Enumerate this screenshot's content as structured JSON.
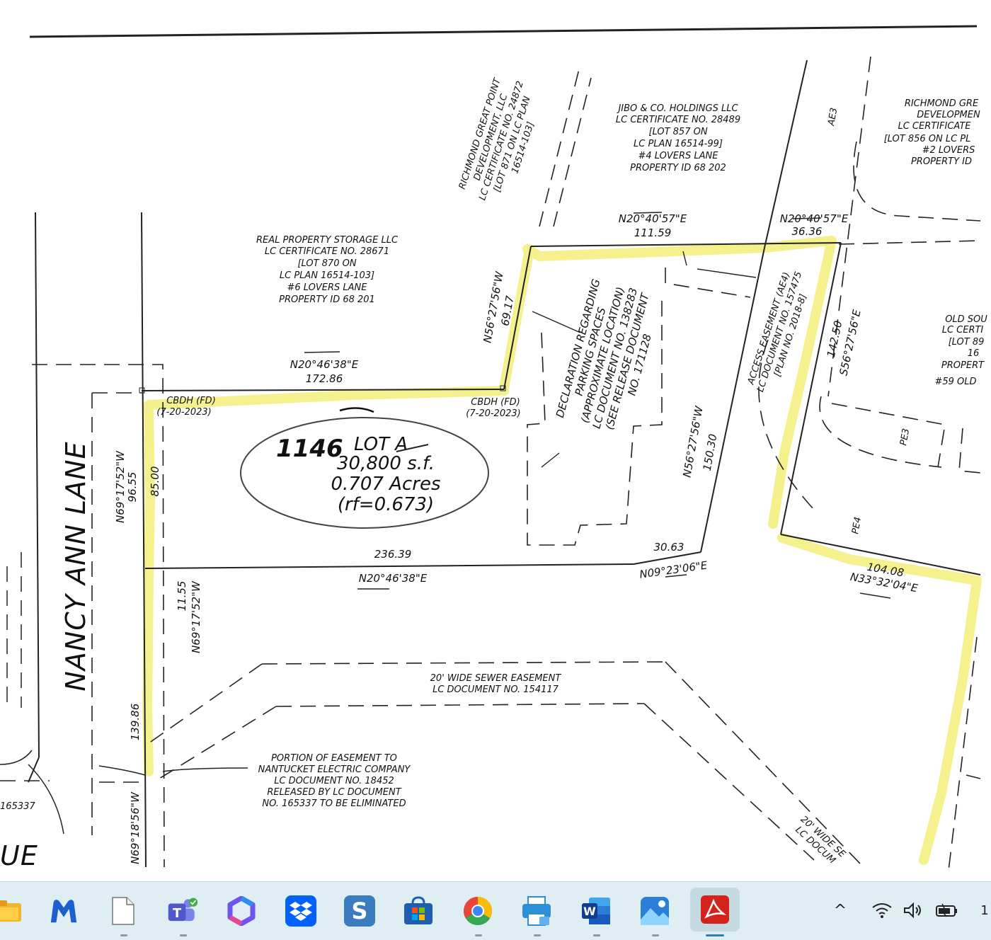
{
  "plan": {
    "top_right_owner": [
      "RICHMOND GRE",
      "DEVELOPMEN",
      "LC CERTIFICATE",
      "[LOT 856 ON LC PL",
      "#2 LOVERS",
      "PROPERTY ID"
    ],
    "jibo": [
      "JIBO & CO. HOLDINGS LLC",
      "LC CERTIFICATE NO. 28489",
      "[LOT 857 ON",
      "LC PLAN 16514-99]",
      "#4 LOVERS LANE",
      "PROPERTY ID 68 202"
    ],
    "richmond_rot": [
      "RICHMOND GREAT POINT",
      "DEVELOPMENT, LLC",
      "LC CERTIFICATE NO. 24872",
      "[LOT 871 ON LC PLAN",
      "16514-103]"
    ],
    "real_property": [
      "REAL PROPERTY STORAGE LLC",
      "LC CERTIFICATE NO. 28671",
      "[LOT 870 ON",
      "LC PLAN 16514-103]",
      "#6 LOVERS LANE",
      "PROPERTY ID 68 201"
    ],
    "old_sou": [
      "OLD SOU",
      "LC CERTI",
      "[LOT 89",
      "16",
      "PROPERT",
      "#59 OLD"
    ],
    "ae3": "AE3",
    "pe3": "PE3",
    "pe4": "PE4",
    "road_name": "NANCY ANN LANE",
    "avenue_fragment": "UE",
    "doc_fragment": "165337",
    "bearings": {
      "top_mid": "N20°40'57\"E",
      "top_mid_dist": "111.59",
      "top_right": "N20°40'57\"E",
      "top_right_dist": "36.36",
      "diag_left": "N56°27'56\"W",
      "diag_left_dist": "69.17",
      "mid_top": "N20°46'38\"E",
      "mid_top_dist": "172.86",
      "cbdh_left": "CBDH (FD)",
      "cbdh_left_date": "(7-20-2023)",
      "cbdh_right": "CBDH (FD)",
      "cbdh_right_date": "(7-20-2023)",
      "right_side_dist": "142.50",
      "right_side": "S56°27'56\"E",
      "inner_diag": "N56°27'56\"W",
      "inner_diag_dist": "150.30",
      "bottom_dist": "236.39",
      "bottom": "N20°46'38\"E",
      "short_dist": "30.63",
      "short": "N09°23'06\"E",
      "lower_right_dist": "104.08",
      "lower_right": "N33°32'04\"E",
      "left_outer": "N69°17'52\"W",
      "left_outer_dist": "96.55",
      "left_inner_dist": "85.00",
      "left_low_dist": "11.55",
      "left_low": "N69°17'52\"W",
      "left_bottom_dist": "139.86",
      "left_bottom": "N69°18'56\"W"
    },
    "parking_decl": [
      "DECLARATION REGARDING",
      "PARKING SPACES",
      "(APPROXIMATE LOCATION)",
      "LC DOCUMENT NO. 138283",
      "(SEE RELEASE DOCUMENT",
      "NO. 171128"
    ],
    "access_easement": [
      "ACCESS EASEMENT (AE4)",
      "LC DOCUMENT NO. 157475",
      "[PLAN NO. 2018-8]"
    ],
    "lot": {
      "number": "1146",
      "name": "LOT A",
      "area_sf": "30,800 s.f.",
      "area_acres": "0.707 Acres",
      "rf": "(rf=0.673)"
    },
    "sewer": [
      "20' WIDE SEWER EASEMENT",
      "LC DOCUMENT NO. 154117"
    ],
    "sewer_right": [
      "20' WIDE SE",
      "LC DOCUM"
    ],
    "electric": [
      "PORTION OF EASEMENT TO",
      "NANTUCKET ELECTRIC COMPANY",
      "LC DOCUMENT NO. 18452",
      "RELEASED BY LC DOCUMENT",
      "NO. 165337 TO BE ELIMINATED"
    ]
  },
  "taskbar": {
    "apps": [
      {
        "name": "file-explorer-icon",
        "color": "#e8a92a"
      },
      {
        "name": "malwarebytes-icon",
        "color": "#1a5fcf"
      },
      {
        "name": "blank-document-icon",
        "color": "#ffffff"
      },
      {
        "name": "teams-icon",
        "color": "#5b5fc7"
      },
      {
        "name": "copilot-icon",
        "color": "#7a5cf0"
      },
      {
        "name": "dropbox-icon",
        "color": "#0061fe"
      },
      {
        "name": "s-app-icon",
        "color": "#3b7bbf"
      },
      {
        "name": "microsoft-store-icon",
        "color": "#1f6fd1"
      },
      {
        "name": "chrome-icon",
        "color": "#e8453c"
      },
      {
        "name": "printer-app-icon",
        "color": "#2d8fd6"
      },
      {
        "name": "word-icon",
        "color": "#1f5bb8"
      },
      {
        "name": "photos-icon",
        "color": "#2a80d6"
      },
      {
        "name": "acrobat-icon",
        "color": "#d4221c"
      }
    ],
    "tray_chevron": "^",
    "clock_fragment": "1"
  }
}
